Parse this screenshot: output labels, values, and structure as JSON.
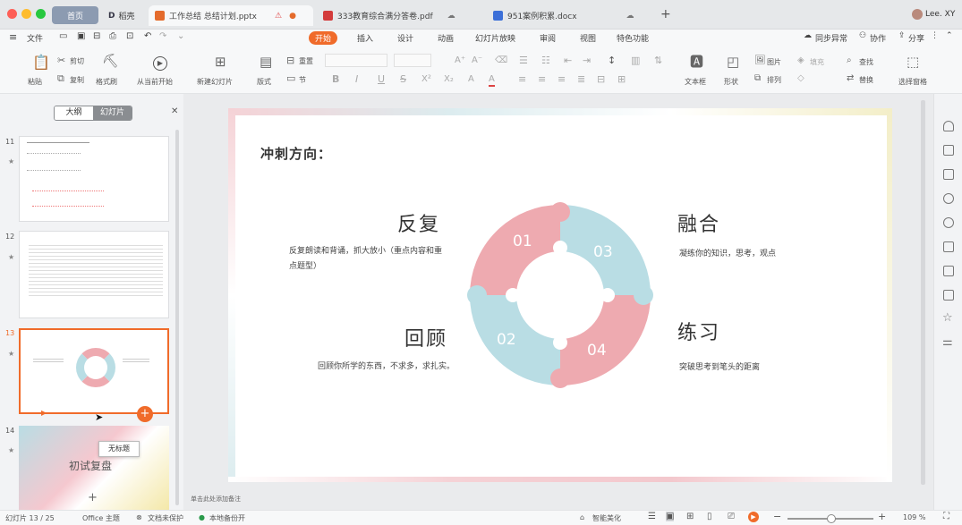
{
  "tabs": {
    "home": "首页",
    "docer": "稻壳",
    "t1": "工作总结 总结计划.pptx",
    "t2": "333教育综合满分答卷.pdf",
    "t3": "951案例积累.docx",
    "user": "Lee. XY"
  },
  "menu": {
    "file": "文件",
    "items": [
      "开始",
      "插入",
      "设计",
      "动画",
      "幻灯片放映",
      "审阅",
      "视图",
      "特色功能"
    ],
    "sync": "同步异常",
    "collab": "协作",
    "share": "分享"
  },
  "toolbar": {
    "paste": "粘贴",
    "cut": "剪切",
    "copy": "复制",
    "format_painter": "格式刷",
    "play_from": "从当前开始",
    "new_slide": "新建幻灯片",
    "layout": "版式",
    "reset": "重置",
    "section": "节",
    "textbox": "文本框",
    "shape": "形状",
    "picture": "图片",
    "arrange": "排列",
    "fill": "填充",
    "find": "查找",
    "replace": "替换",
    "select_pane": "选择窗格"
  },
  "sidebar": {
    "seg_outline": "大纲",
    "seg_slides": "幻灯片",
    "nums": [
      "11",
      "12",
      "13",
      "14"
    ],
    "tooltip": "无标题",
    "slide14_text": "初试复盘"
  },
  "slide": {
    "heading": "冲刺方向：",
    "q1_title": "反复",
    "q1_desc": "反复朗读和背诵，抓大放小（重点内容和重点题型）",
    "q2_title": "融合",
    "q2_desc": "凝练你的知识，思考，观点",
    "q3_title": "回顾",
    "q3_desc": "回顾你所学的东西，不求多，求扎实。",
    "q4_title": "练习",
    "q4_desc": "突破思考到笔头的距离",
    "n1": "01",
    "n2": "02",
    "n3": "03",
    "n4": "04"
  },
  "notes_placeholder": "单击此处添加备注",
  "status": {
    "slide_count": "幻灯片 13 / 25",
    "theme": "Office 主题",
    "protect": "文档未保护",
    "backup": "本地备份开",
    "beautify": "智能美化",
    "zoom": "109 %"
  },
  "colors": {
    "accent": "#f06b2a",
    "pink": "#eeaab0",
    "blue": "#b9dde4"
  }
}
